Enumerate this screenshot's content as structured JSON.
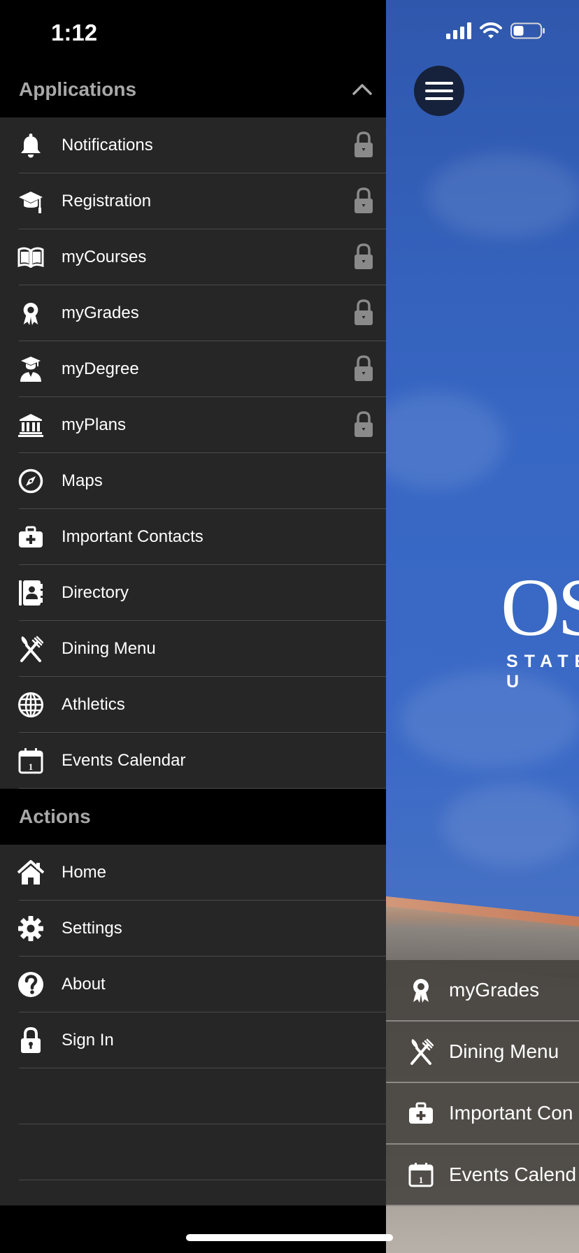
{
  "status_bar": {
    "time": "1:12"
  },
  "applications": {
    "title": "Applications",
    "items": [
      {
        "label": "Notifications",
        "icon": "bell-icon",
        "locked": true
      },
      {
        "label": "Registration",
        "icon": "graduation-cap-icon",
        "locked": true
      },
      {
        "label": "myCourses",
        "icon": "open-book-icon",
        "locked": true
      },
      {
        "label": "myGrades",
        "icon": "award-ribbon-icon",
        "locked": true
      },
      {
        "label": "myDegree",
        "icon": "graduate-person-icon",
        "locked": true
      },
      {
        "label": "myPlans",
        "icon": "institution-icon",
        "locked": true
      },
      {
        "label": "Maps",
        "icon": "compass-icon",
        "locked": false
      },
      {
        "label": "Important Contacts",
        "icon": "first-aid-kit-icon",
        "locked": false
      },
      {
        "label": "Directory",
        "icon": "address-book-icon",
        "locked": false
      },
      {
        "label": "Dining Menu",
        "icon": "fork-knife-icon",
        "locked": false
      },
      {
        "label": "Athletics",
        "icon": "globe-icon",
        "locked": false
      },
      {
        "label": "Events Calendar",
        "icon": "calendar-icon",
        "locked": false
      }
    ]
  },
  "actions": {
    "title": "Actions",
    "items": [
      {
        "label": "Home",
        "icon": "home-icon"
      },
      {
        "label": "Settings",
        "icon": "gear-icon"
      },
      {
        "label": "About",
        "icon": "question-circle-icon"
      },
      {
        "label": "Sign In",
        "icon": "padlock-icon"
      }
    ]
  },
  "background_app": {
    "logo_text": "OS",
    "logo_subtext": "STATE U",
    "quick_items": [
      {
        "label": "myGrades",
        "icon": "award-ribbon-icon"
      },
      {
        "label": "Dining Menu",
        "icon": "fork-knife-icon"
      },
      {
        "label": "Important Con",
        "icon": "first-aid-kit-icon"
      },
      {
        "label": "Events Calend",
        "icon": "calendar-icon"
      }
    ]
  },
  "colors": {
    "drawer_bg": "#262626",
    "header_bg": "#000000",
    "header_text": "#a8a8a8",
    "lock_icon": "#8a8a8a",
    "menu_button": "#16213b"
  }
}
